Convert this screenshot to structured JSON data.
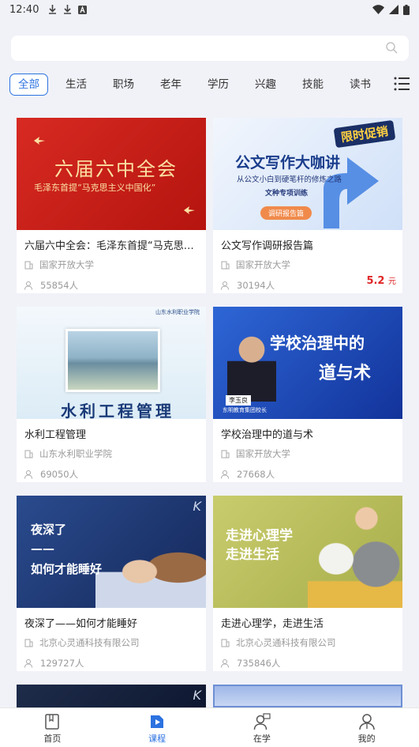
{
  "status": {
    "time": "12:40"
  },
  "search": {
    "placeholder": ""
  },
  "tabs": [
    "全部",
    "生活",
    "职场",
    "老年",
    "学历",
    "兴趣",
    "技能",
    "读书"
  ],
  "courses": [
    {
      "title": "六届六中全会：毛泽东首提“马克思主...",
      "school": "国家开放大学",
      "learners": "55854人",
      "thumb_text": [
        "六届六中全会",
        "毛泽东首提“马克思主义中国化”"
      ],
      "thumb_color": "#c9211d"
    },
    {
      "title": "公文写作调研报告篇",
      "school": "国家开放大学",
      "learners": "30194人",
      "price": "5.2",
      "price_unit": "元",
      "thumb_text": [
        "公文写作大咖讲",
        "从公文小白到硬笔杆的修炼之路",
        "文种专项训练",
        "调研报告篇",
        "限时促销"
      ],
      "thumb_color": "#e8f0fb"
    },
    {
      "title": "水利工程管理",
      "school": "山东水利职业学院",
      "learners": "69050人",
      "thumb_text": [
        "水利工程管理",
        "山东水利职业学院"
      ],
      "thumb_color": "#eaf4fa"
    },
    {
      "title": "学校治理中的道与术",
      "school": "国家开放大学",
      "learners": "27668人",
      "thumb_text": [
        "学校治理中的",
        "道与术",
        "李玉良",
        "东明教育集团校长"
      ],
      "thumb_color": "#1f4ab0"
    },
    {
      "title": "夜深了——如何才能睡好",
      "school": "北京心灵通科技有限公司",
      "learners": "129727人",
      "thumb_text": [
        "夜深了",
        "——",
        "如何才能睡好"
      ],
      "thumb_color": "#21407e"
    },
    {
      "title": "走进心理学，走进生活",
      "school": "北京心灵通科技有限公司",
      "learners": "735846人",
      "thumb_text": [
        "走进心理学",
        "走进生活"
      ],
      "thumb_color": "#b9c05a"
    }
  ],
  "nav": [
    {
      "label": "首页",
      "icon": "book-icon"
    },
    {
      "label": "课程",
      "icon": "play-icon"
    },
    {
      "label": "在学",
      "icon": "user-study-icon"
    },
    {
      "label": "我的",
      "icon": "profile-icon"
    }
  ]
}
